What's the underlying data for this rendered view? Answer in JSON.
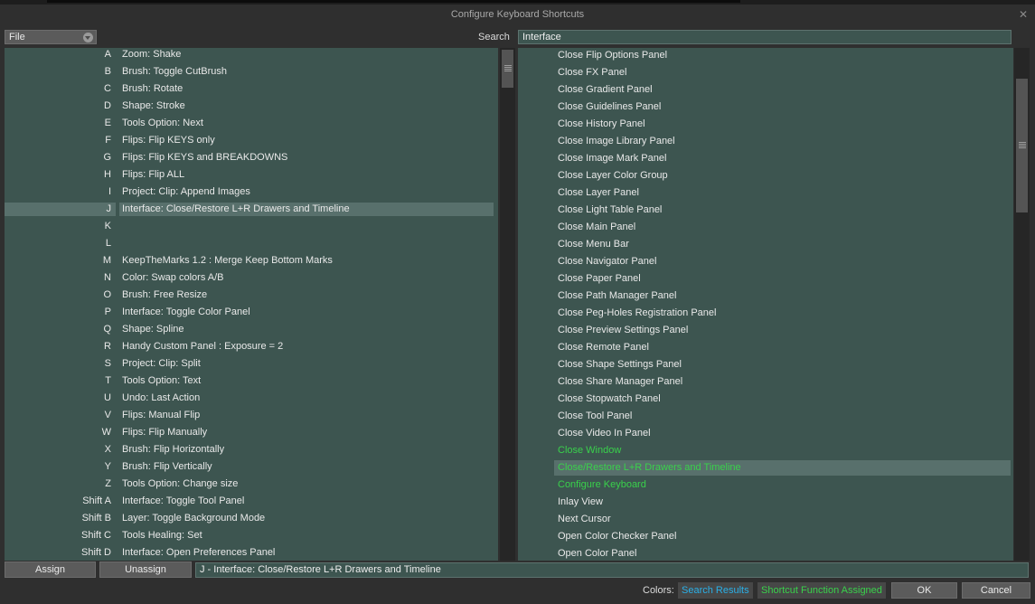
{
  "window": {
    "title": "Configure Keyboard Shortcuts"
  },
  "file_dropdown": {
    "selected": "File"
  },
  "search": {
    "label": "Search",
    "value": "Interface"
  },
  "shortcuts": [
    {
      "key": "A",
      "action": "Zoom: Shake"
    },
    {
      "key": "B",
      "action": "Brush: Toggle CutBrush"
    },
    {
      "key": "C",
      "action": "Brush: Rotate"
    },
    {
      "key": "D",
      "action": "Shape: Stroke"
    },
    {
      "key": "E",
      "action": "Tools Option: Next"
    },
    {
      "key": "F",
      "action": "Flips: Flip KEYS only"
    },
    {
      "key": "G",
      "action": "Flips: Flip KEYS and BREAKDOWNS"
    },
    {
      "key": "H",
      "action": "Flips: Flip ALL"
    },
    {
      "key": "I",
      "action": "Project: Clip: Append Images"
    },
    {
      "key": "J",
      "action": "Interface: Close/Restore L+R Drawers and Timeline",
      "selected": true
    },
    {
      "key": "K",
      "action": ""
    },
    {
      "key": "L",
      "action": ""
    },
    {
      "key": "M",
      "action": "KeepTheMarks 1.2 : Merge Keep Bottom Marks"
    },
    {
      "key": "N",
      "action": "Color: Swap colors A/B"
    },
    {
      "key": "O",
      "action": "Brush: Free Resize"
    },
    {
      "key": "P",
      "action": "Interface: Toggle Color Panel"
    },
    {
      "key": "Q",
      "action": "Shape: Spline"
    },
    {
      "key": "R",
      "action": "Handy Custom Panel : Exposure = 2"
    },
    {
      "key": "S",
      "action": "Project: Clip: Split"
    },
    {
      "key": "T",
      "action": "Tools Option: Text"
    },
    {
      "key": "U",
      "action": "Undo: Last Action"
    },
    {
      "key": "V",
      "action": "Flips: Manual Flip"
    },
    {
      "key": "W",
      "action": "Flips: Flip Manually"
    },
    {
      "key": "X",
      "action": "Brush: Flip Horizontally"
    },
    {
      "key": "Y",
      "action": "Brush: Flip Vertically"
    },
    {
      "key": "Z",
      "action": "Tools Option: Change size"
    },
    {
      "key": "Shift A",
      "action": "Interface: Toggle Tool Panel"
    },
    {
      "key": "Shift B",
      "action": "Layer: Toggle Background Mode"
    },
    {
      "key": "Shift C",
      "action": "Tools Healing: Set"
    },
    {
      "key": "Shift D",
      "action": "Interface: Open Preferences Panel"
    }
  ],
  "functions": [
    {
      "label": "Close Flip Options Panel"
    },
    {
      "label": "Close FX Panel"
    },
    {
      "label": "Close Gradient Panel"
    },
    {
      "label": "Close Guidelines Panel"
    },
    {
      "label": "Close History Panel"
    },
    {
      "label": "Close Image Library Panel"
    },
    {
      "label": "Close Image Mark Panel"
    },
    {
      "label": "Close Layer Color Group"
    },
    {
      "label": "Close Layer Panel"
    },
    {
      "label": "Close Light Table Panel"
    },
    {
      "label": "Close Main Panel"
    },
    {
      "label": "Close Menu Bar"
    },
    {
      "label": "Close Navigator Panel"
    },
    {
      "label": "Close Paper Panel"
    },
    {
      "label": "Close Path Manager Panel"
    },
    {
      "label": "Close Peg-Holes Registration Panel"
    },
    {
      "label": "Close Preview Settings Panel"
    },
    {
      "label": "Close Remote Panel"
    },
    {
      "label": "Close Shape Settings Panel"
    },
    {
      "label": "Close Share Manager Panel"
    },
    {
      "label": "Close Stopwatch Panel"
    },
    {
      "label": "Close Tool Panel"
    },
    {
      "label": "Close Video In Panel"
    },
    {
      "label": "Close Window",
      "assigned": true
    },
    {
      "label": "Close/Restore L+R Drawers and Timeline",
      "assigned": true,
      "selected": true
    },
    {
      "label": "Configure Keyboard",
      "assigned": true
    },
    {
      "label": "Inlay View"
    },
    {
      "label": "Next Cursor"
    },
    {
      "label": "Open Color Checker Panel"
    },
    {
      "label": "Open Color Panel"
    }
  ],
  "buttons": {
    "assign": "Assign",
    "unassign": "Unassign",
    "ok": "OK",
    "cancel": "Cancel"
  },
  "status_text": "J - Interface: Close/Restore L+R Drawers and Timeline",
  "legend": {
    "label": "Colors:",
    "search_results": "Search Results",
    "shortcut_assigned": "Shortcut Function Assigned",
    "search_results_color": "#2ab0e8",
    "assigned_color": "#39d14b"
  },
  "icons": {
    "close": "close-icon",
    "dropdown": "chevron-down-icon"
  }
}
